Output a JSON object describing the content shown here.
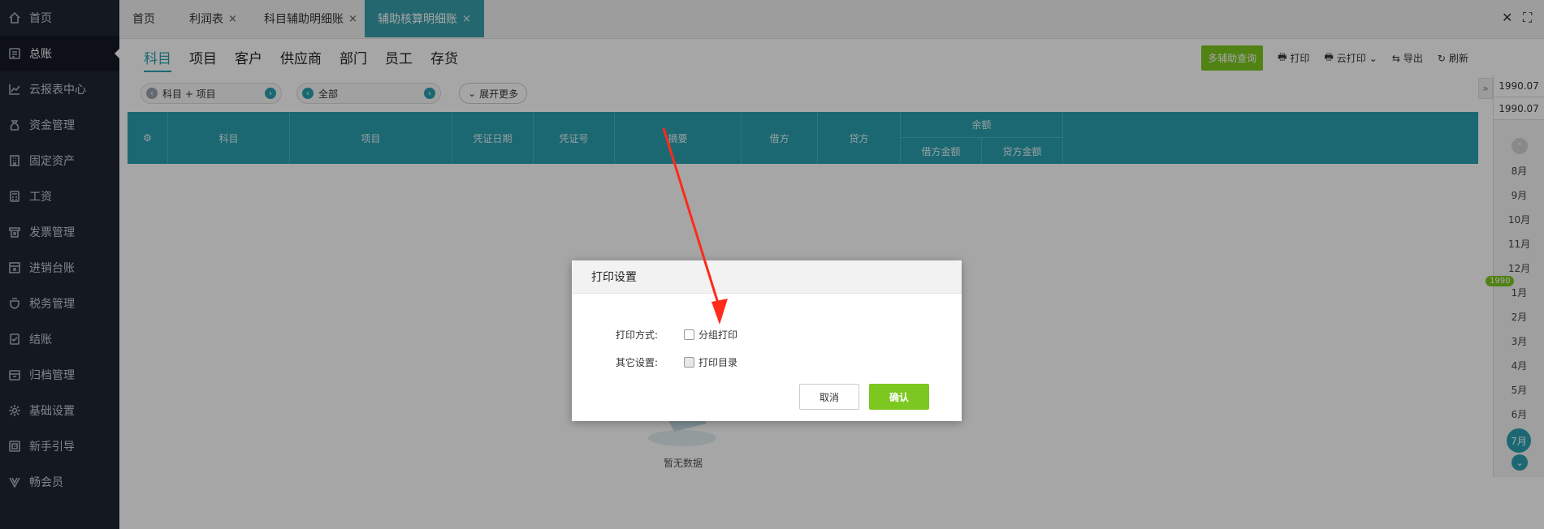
{
  "sidebar": {
    "items": [
      {
        "label": "首页",
        "icon": "home-icon"
      },
      {
        "label": "总账",
        "icon": "ledger-icon"
      },
      {
        "label": "云报表中心",
        "icon": "chart-icon"
      },
      {
        "label": "资金管理",
        "icon": "money-bag-icon"
      },
      {
        "label": "固定资产",
        "icon": "building-icon"
      },
      {
        "label": "工资",
        "icon": "calculator-icon"
      },
      {
        "label": "发票管理",
        "icon": "invoice-icon"
      },
      {
        "label": "进销台账",
        "icon": "inventory-icon"
      },
      {
        "label": "税务管理",
        "icon": "tax-icon"
      },
      {
        "label": "结账",
        "icon": "checkout-icon"
      },
      {
        "label": "归档管理",
        "icon": "archive-icon"
      },
      {
        "label": "基础设置",
        "icon": "gear-icon"
      },
      {
        "label": "新手引导",
        "icon": "guide-icon"
      },
      {
        "label": "畅会员",
        "icon": "vip-icon"
      }
    ]
  },
  "tabs": [
    {
      "label": "首页",
      "close": ""
    },
    {
      "label": "利润表",
      "close": "×"
    },
    {
      "label": "科目辅助明细账",
      "close": "×"
    },
    {
      "label": "辅助核算明细账",
      "close": "×"
    }
  ],
  "topbar": {
    "close": "✕",
    "fullscreen": "⛶"
  },
  "subtabs": [
    "科目",
    "项目",
    "客户",
    "供应商",
    "部门",
    "员工",
    "存货"
  ],
  "actions": {
    "multi_query": "多辅助查询",
    "print": "打印",
    "cloud_print": "云打印",
    "export": "导出",
    "refresh": "刷新"
  },
  "filters": {
    "filter1": "科目 + 项目",
    "filter2": "全部",
    "expand": "展开更多"
  },
  "table": {
    "headers": {
      "subject": "科目",
      "project": "项目",
      "voucher_date": "凭证日期",
      "voucher_no": "凭证号",
      "summary": "摘要",
      "debit": "借方",
      "credit": "贷方",
      "balance": "余额",
      "debit_amount": "借方金额",
      "credit_amount": "贷方金额"
    },
    "empty": "暂无数据"
  },
  "timeline": {
    "year_start": "1990.07",
    "year_end": "1990.07",
    "year_badge": "1990",
    "months": [
      "8月",
      "9月",
      "10月",
      "11月",
      "12月",
      "1月",
      "2月",
      "3月",
      "4月",
      "5月",
      "6月"
    ],
    "selected": "7月"
  },
  "modal": {
    "title": "打印设置",
    "print_mode_label": "打印方式:",
    "group_print": "分组打印",
    "other_label": "其它设置:",
    "print_catalog": "打印目录",
    "cancel": "取消",
    "confirm": "确认"
  },
  "colors": {
    "sidebar_bg": "#1f2533",
    "teal": "#2aa0b0",
    "green": "#7cc820",
    "arrow": "#ff2a1a"
  }
}
